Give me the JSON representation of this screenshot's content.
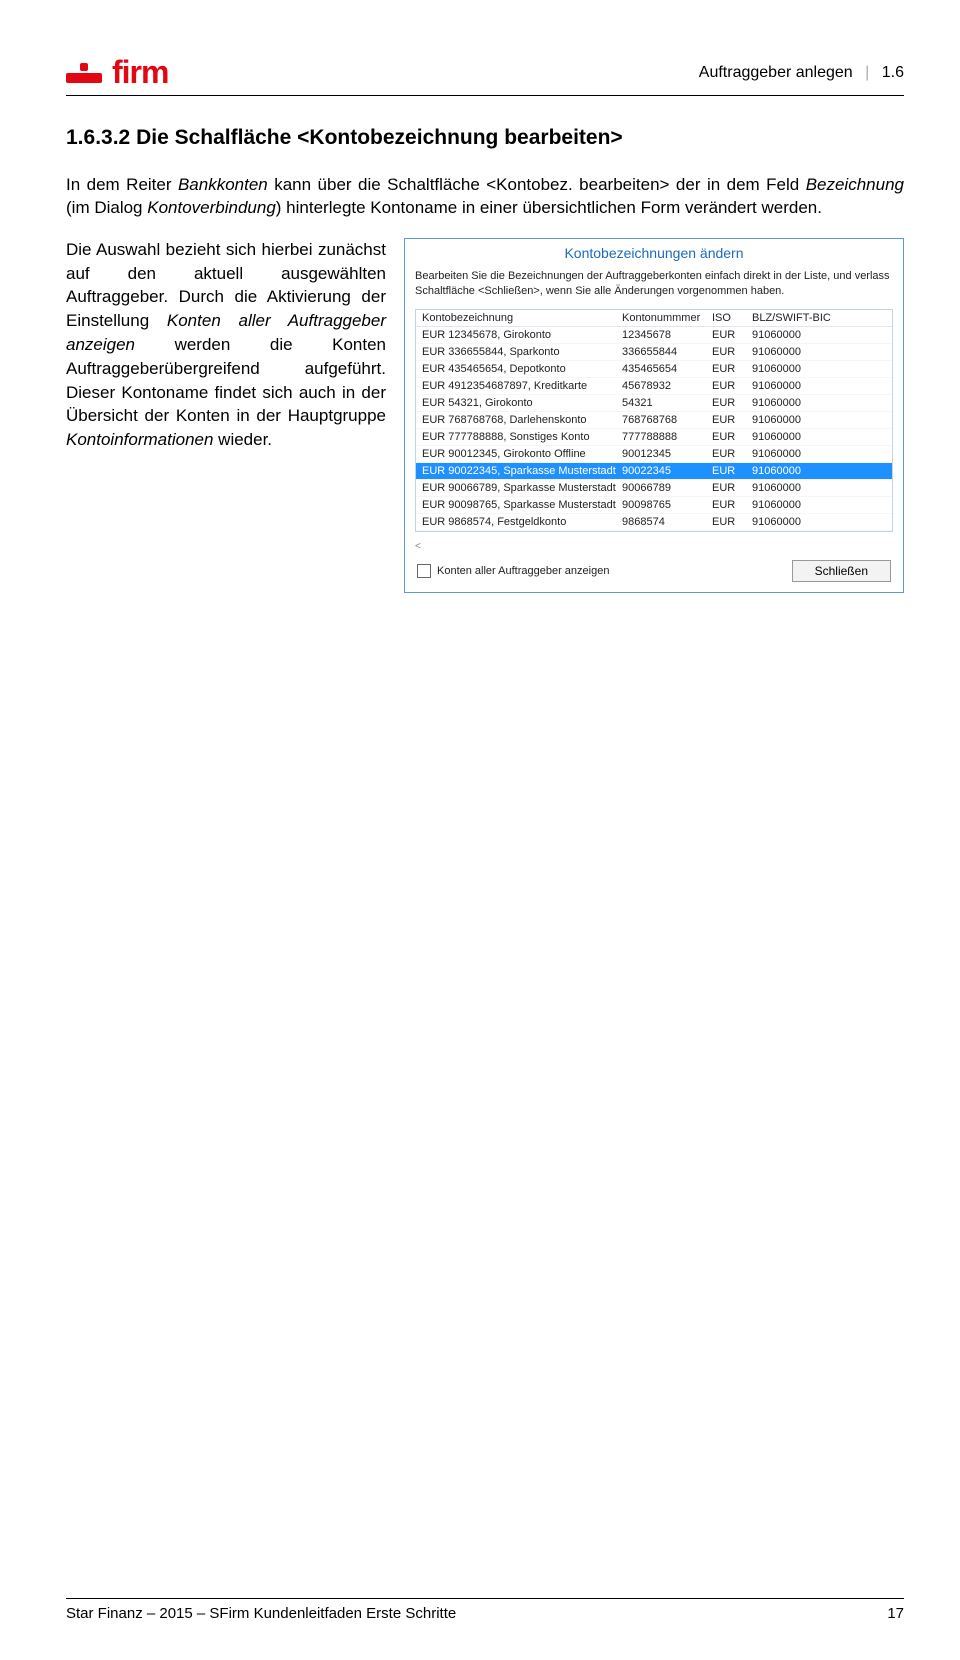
{
  "header": {
    "logo_text": "firm",
    "breadcrumb_title": "Auftraggeber anlegen",
    "breadcrumb_section": "1.6"
  },
  "section": {
    "num": "1.6.3.2",
    "title": "Die Schalfläche <Kontobezeichnung bearbeiten>"
  },
  "para1_a": "In dem Reiter ",
  "para1_i1": "Bankkonten",
  "para1_b": " kann über die Schaltfläche <Kontobez. bearbeiten> der in dem Feld ",
  "para1_i2": "Bezeichnung",
  "para1_c": " (im Dialog ",
  "para1_i3": "Kontoverbindung",
  "para1_d": ") hinterlegte Kontoname in einer übersichtlichen Form verändert werden.",
  "left_a": "Die Auswahl bezieht sich hierbei zunächst auf den aktuell ausgewählten Auftraggeber. Durch die Aktivierung der Einstellung ",
  "left_i1": "Konten aller Auftraggeber anzeigen",
  "left_b": " werden die Konten Auftraggeberübergreifend aufgeführt. Dieser Kontoname findet sich auch in der Übersicht der Konten in der Hauptgruppe ",
  "left_i2": "Kontoinformationen",
  "left_c": " wieder.",
  "dialog": {
    "title": "Kontobezeichnungen ändern",
    "desc1": "Bearbeiten Sie die Bezeichnungen der Auftraggeberkonten einfach direkt in der Liste, und verlass",
    "desc2": "Schaltfläche <Schließen>, wenn Sie alle Änderungen vorgenommen haben.",
    "cols": [
      "Kontobezeichnung",
      "Kontonummmer",
      "ISO",
      "BLZ/SWIFT-BIC"
    ],
    "rows": [
      {
        "name": "EUR 12345678, Girokonto",
        "num": "12345678",
        "iso": "EUR",
        "blz": "91060000",
        "sel": false
      },
      {
        "name": "EUR 336655844, Sparkonto",
        "num": "336655844",
        "iso": "EUR",
        "blz": "91060000",
        "sel": false
      },
      {
        "name": "EUR 435465654, Depotkonto",
        "num": "435465654",
        "iso": "EUR",
        "blz": "91060000",
        "sel": false
      },
      {
        "name": "EUR 4912354687897, Kreditkarte",
        "num": "45678932",
        "iso": "EUR",
        "blz": "91060000",
        "sel": false
      },
      {
        "name": "EUR 54321, Girokonto",
        "num": "54321",
        "iso": "EUR",
        "blz": "91060000",
        "sel": false
      },
      {
        "name": "EUR 768768768, Darlehenskonto",
        "num": "768768768",
        "iso": "EUR",
        "blz": "91060000",
        "sel": false
      },
      {
        "name": "EUR 777788888, Sonstiges Konto",
        "num": "777788888",
        "iso": "EUR",
        "blz": "91060000",
        "sel": false
      },
      {
        "name": "EUR 90012345, Girokonto Offline",
        "num": "90012345",
        "iso": "EUR",
        "blz": "91060000",
        "sel": false
      },
      {
        "name": "EUR 90022345, Sparkasse Musterstadt",
        "num": "90022345",
        "iso": "EUR",
        "blz": "91060000",
        "sel": true
      },
      {
        "name": "EUR 90066789, Sparkasse Musterstadt",
        "num": "90066789",
        "iso": "EUR",
        "blz": "91060000",
        "sel": false
      },
      {
        "name": "EUR 90098765, Sparkasse Musterstadt",
        "num": "90098765",
        "iso": "EUR",
        "blz": "91060000",
        "sel": false
      },
      {
        "name": "EUR 9868574, Festgeldkonto",
        "num": "9868574",
        "iso": "EUR",
        "blz": "91060000",
        "sel": false
      }
    ],
    "scroll_hint": "<",
    "checkbox_label": "Konten aller Auftraggeber anzeigen",
    "close_label": "Schließen"
  },
  "footer": {
    "left": "Star Finanz – 2015 – SFirm Kundenleitfaden Erste Schritte",
    "right": "17"
  }
}
